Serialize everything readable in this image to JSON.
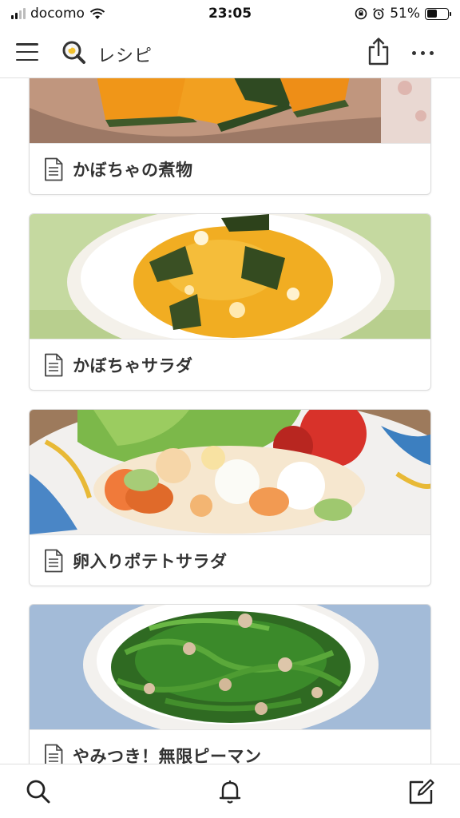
{
  "status_bar": {
    "carrier": "docomo",
    "time": "23:05",
    "battery_percent_text": "51%",
    "battery_level": 0.51
  },
  "nav": {
    "title": "レシピ"
  },
  "recipes": [
    {
      "title": "かぼちゃの煮物"
    },
    {
      "title": "かぼちゃサラダ"
    },
    {
      "title": "卵入りポテトサラダ"
    },
    {
      "title": "やみつき！無限ピーマン"
    }
  ],
  "icons": {
    "menu": "hamburger-icon",
    "logo": "search-app-logo",
    "share": "share-icon",
    "more": "more-icon",
    "document": "document-icon",
    "search": "search-icon",
    "notifications": "bell-icon",
    "compose": "compose-icon"
  }
}
